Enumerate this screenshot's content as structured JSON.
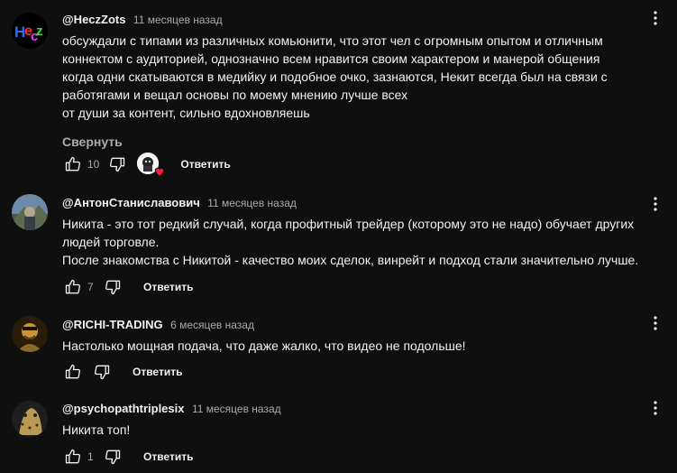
{
  "reply_label": "Ответить",
  "comments": [
    {
      "author": "@HeczZots",
      "time": "11 месяцев назад",
      "lines": [
        "обсуждали с типами из различных комьюнити, что этот чел с огромным опытом и отличным",
        "коннектом с аудиторией, однозначно всем нравится своим характером и манерой общения",
        "когда одни скатываются в медийку и подобное очко, зазнаются, Некит всегда был на связи с",
        "работягами и вещал основы по моему мнению лучше всех",
        "от души за контент, сильно вдохновляешь"
      ],
      "collapse_label": "Свернуть",
      "likes": "10",
      "creator_heart": true
    },
    {
      "author": "@АнтонСтаниславович",
      "time": "11 месяцев назад",
      "lines": [
        "Никита - это тот редкий случай, когда профитный трейдер (которому это не надо) обучает других",
        "людей торговле.",
        "После знакомства с Никитой - качество моих сделок, винрейт и подход стали значительно лучше."
      ],
      "likes": "7"
    },
    {
      "author": "@RICHI-TRADING",
      "time": "6 месяцев назад",
      "lines": [
        "Настолько мощная подача, что даже жалко, что видео не подольше!"
      ],
      "likes": ""
    },
    {
      "author": "@psychopathtriplesix",
      "time": "11 месяцев назад",
      "lines": [
        "Никита топ!"
      ],
      "likes": "1"
    }
  ]
}
